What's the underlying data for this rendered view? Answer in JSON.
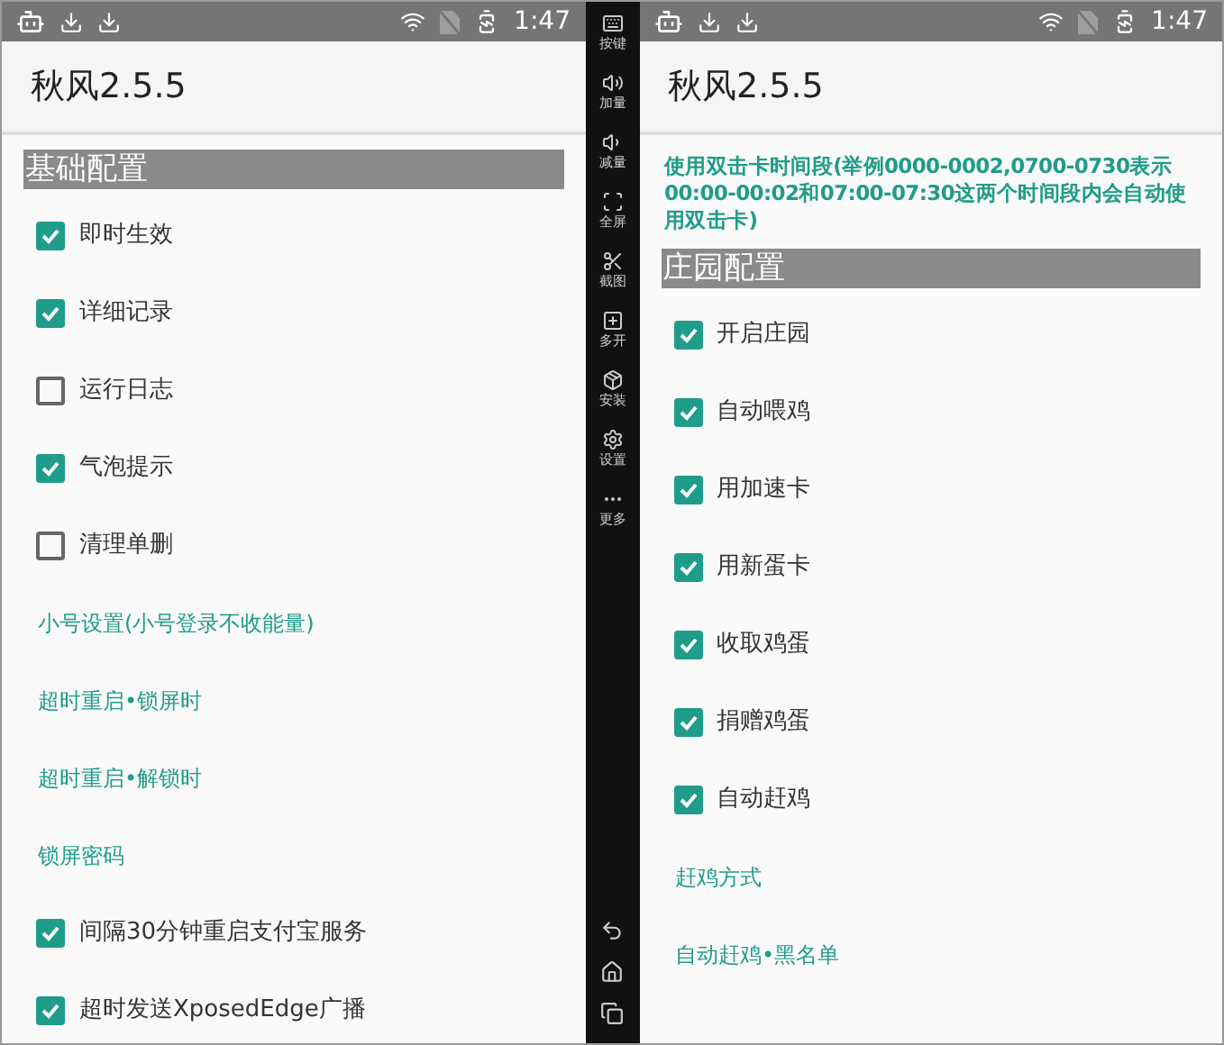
{
  "left_screen": {
    "status_bar": {
      "time": "1:47"
    },
    "app_bar": {
      "title": "秋风2.5.5"
    },
    "items": [
      {
        "kind": "header",
        "label": "基础配置"
      },
      {
        "kind": "check",
        "label": "即时生效",
        "checked": true
      },
      {
        "kind": "check",
        "label": "详细记录",
        "checked": true
      },
      {
        "kind": "check",
        "label": "运行日志",
        "checked": false
      },
      {
        "kind": "check",
        "label": "气泡提示",
        "checked": true
      },
      {
        "kind": "check",
        "label": "清理单删",
        "checked": false
      },
      {
        "kind": "link",
        "label": "小号设置(小号登录不收能量)"
      },
      {
        "kind": "link",
        "label": "超时重启•锁屏时"
      },
      {
        "kind": "link",
        "label": "超时重启•解锁时"
      },
      {
        "kind": "link",
        "label": "锁屏密码"
      },
      {
        "kind": "check",
        "label": "间隔30分钟重启支付宝服务",
        "checked": true
      },
      {
        "kind": "check",
        "label": "超时发送XposedEdge广播",
        "checked": true
      }
    ]
  },
  "side_bar": {
    "buttons": [
      {
        "kind": "keyboard",
        "label": "按键"
      },
      {
        "kind": "volume-up",
        "label": "加量"
      },
      {
        "kind": "volume-down",
        "label": "减量"
      },
      {
        "kind": "fullscreen",
        "label": "全屏"
      },
      {
        "kind": "screenshot",
        "label": "截图"
      },
      {
        "kind": "multi",
        "label": "多开"
      },
      {
        "kind": "install",
        "label": "安装"
      },
      {
        "kind": "settings",
        "label": "设置"
      },
      {
        "kind": "more",
        "label": "更多"
      }
    ]
  },
  "right_screen": {
    "status_bar": {
      "time": "1:47"
    },
    "app_bar": {
      "title": "秋风2.5.5"
    },
    "items": [
      {
        "kind": "note",
        "label": "使用双击卡时间段(举例0000-0002,0700-0730表示00:00-00:02和07:00-07:30这两个时间段内会自动使用双击卡)"
      },
      {
        "kind": "header",
        "label": "庄园配置"
      },
      {
        "kind": "check",
        "label": "开启庄园",
        "checked": true
      },
      {
        "kind": "check",
        "label": "自动喂鸡",
        "checked": true
      },
      {
        "kind": "check",
        "label": "用加速卡",
        "checked": true
      },
      {
        "kind": "check",
        "label": "用新蛋卡",
        "checked": true
      },
      {
        "kind": "check",
        "label": "收取鸡蛋",
        "checked": true
      },
      {
        "kind": "check",
        "label": "捐赠鸡蛋",
        "checked": true
      },
      {
        "kind": "check",
        "label": "自动赶鸡",
        "checked": true
      },
      {
        "kind": "link",
        "label": "赶鸡方式"
      },
      {
        "kind": "link",
        "label": "自动赶鸡•黑名单"
      }
    ]
  }
}
